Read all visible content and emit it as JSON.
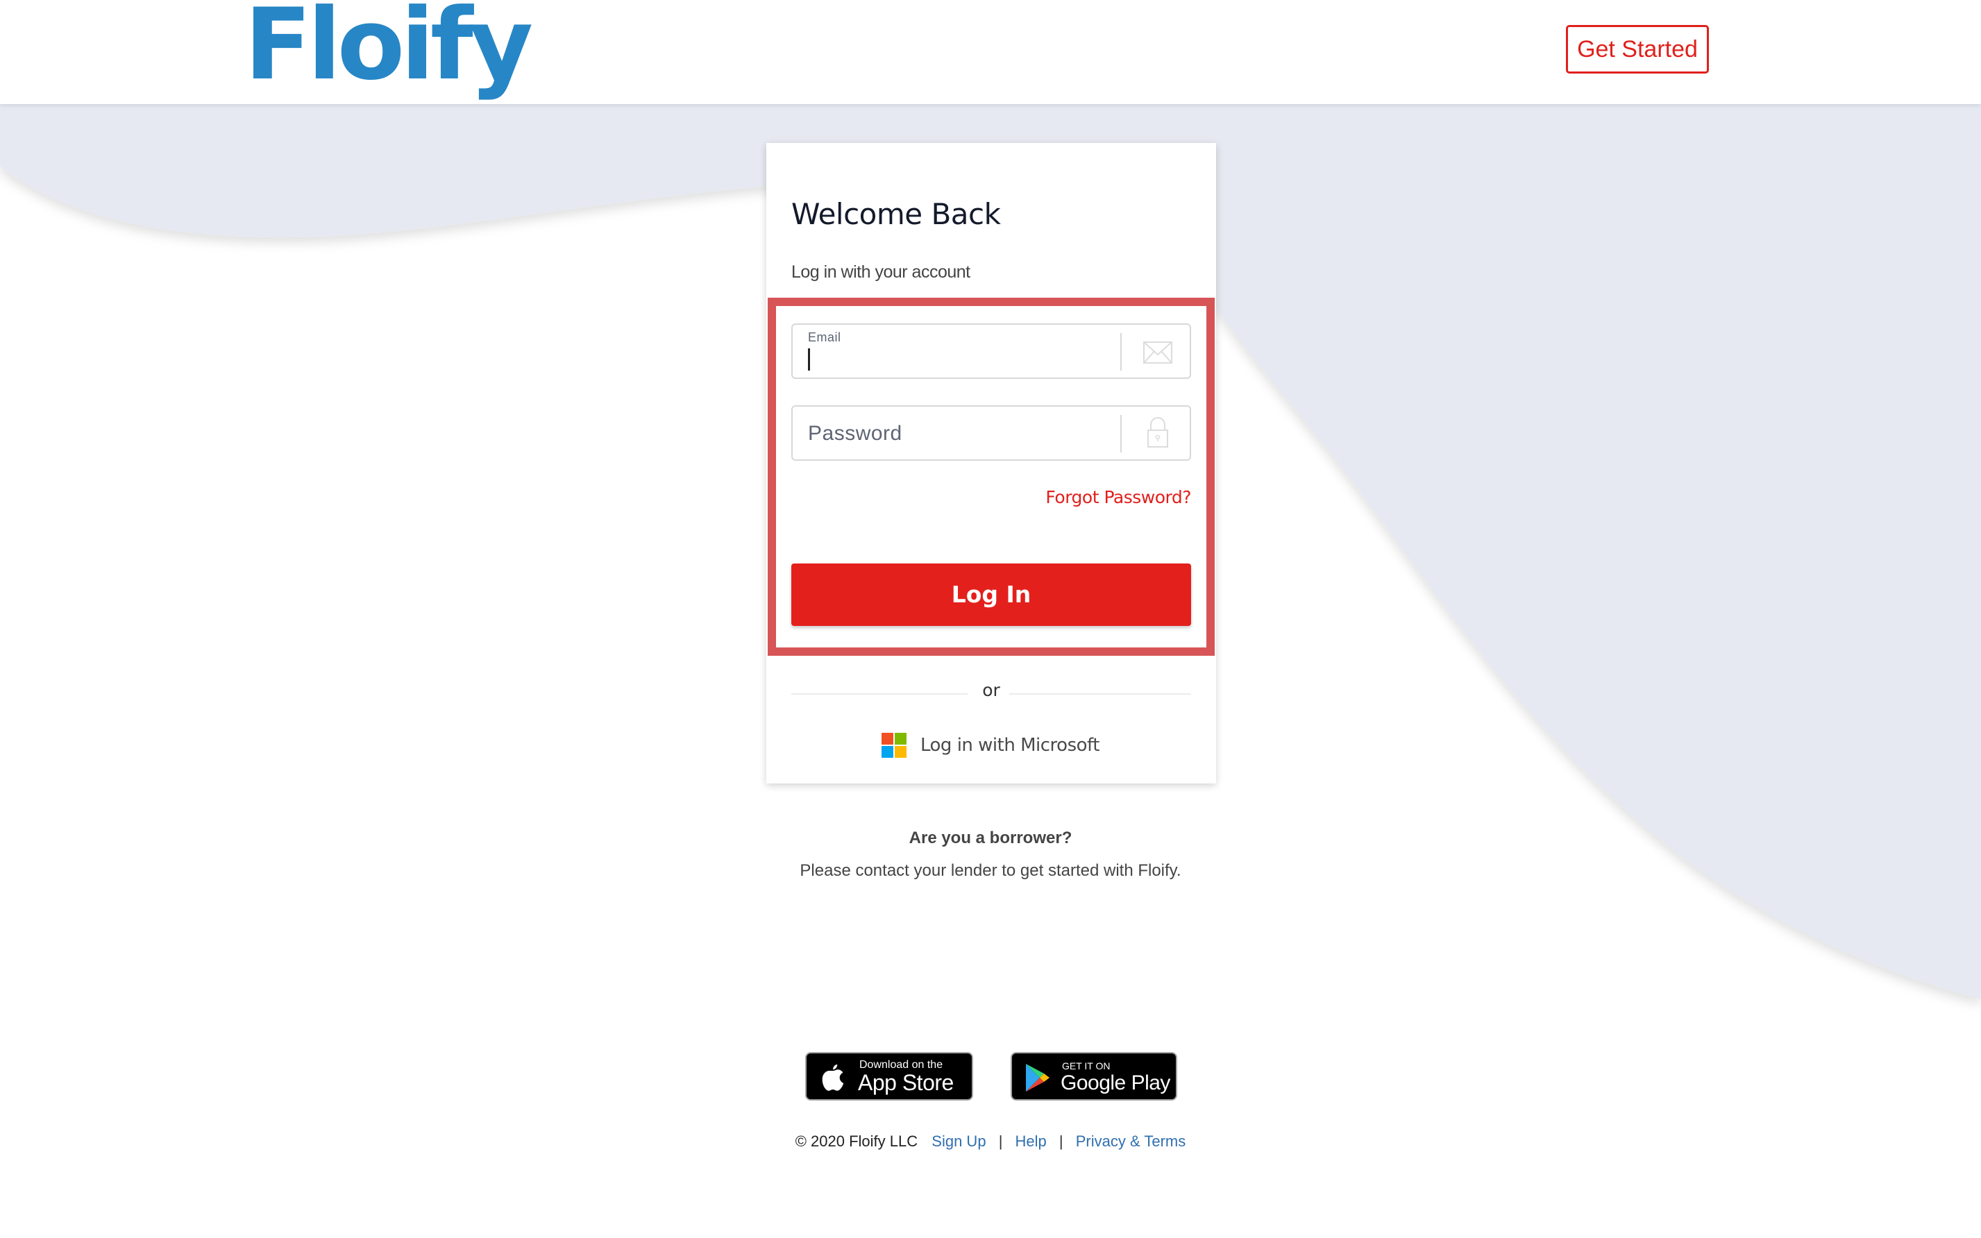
{
  "header": {
    "logo_text": "Floify",
    "get_started_label": "Get Started",
    "brand_color": "#2786c6",
    "accent_color": "#e0201c"
  },
  "login_card": {
    "title": "Welcome Back",
    "subtitle": "Log in with your account",
    "email": {
      "label": "Email",
      "value": "",
      "icon": "envelope-icon"
    },
    "password": {
      "placeholder": "Password",
      "value": "",
      "icon": "lock-icon"
    },
    "forgot_password_label": "Forgot Password?",
    "login_button_label": "Log In",
    "divider_text": "or",
    "microsoft_login_label": "Log in with Microsoft",
    "highlight_color": "#d75556"
  },
  "borrower": {
    "title": "Are you a borrower?",
    "text": "Please contact your lender to get started with Floify."
  },
  "app_badges": {
    "apple": {
      "small": "Download on the",
      "big": "App Store"
    },
    "google": {
      "small": "GET IT ON",
      "big": "Google Play"
    }
  },
  "footer": {
    "copyright": "© 2020 Floify LLC",
    "links": [
      "Sign Up",
      "Help",
      "Privacy & Terms"
    ],
    "separator": "|"
  }
}
